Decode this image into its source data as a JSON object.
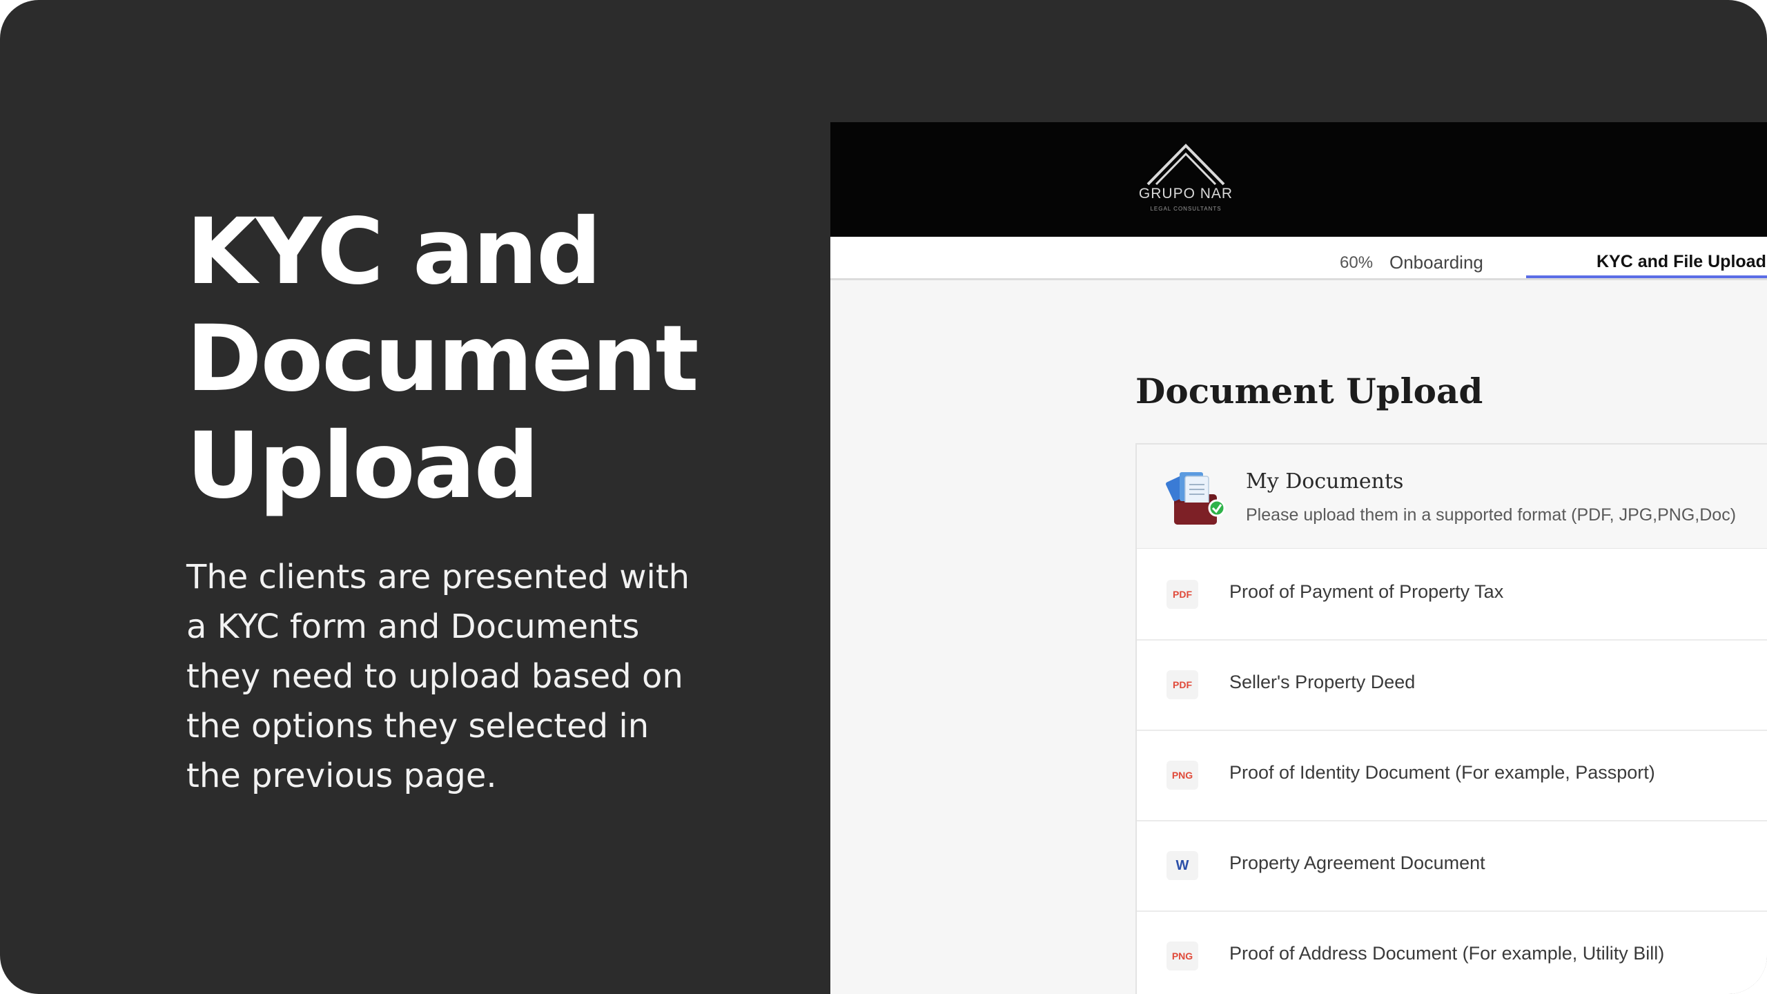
{
  "hero": {
    "title": "KYC and Document Upload",
    "description": "The clients are presented with a KYC form and Documents they need to upload based on the options they selected in the previous page."
  },
  "app": {
    "logo": {
      "wordmark": "GRUPO NAR",
      "subtitle": "LEGAL CONSULTANTS"
    },
    "tabs": {
      "progress": "60%",
      "onboarding": "Onboarding",
      "kyc": "KYC and File Upload"
    },
    "section_title": "Document Upload",
    "my_documents": {
      "title": "My Documents",
      "subtitle": "Please upload them in a supported format (PDF, JPG,PNG,Doc)"
    },
    "documents": [
      {
        "badge": "PDF",
        "label": "Proof of Payment of Property Tax"
      },
      {
        "badge": "PDF",
        "label": "Seller's Property Deed"
      },
      {
        "badge": "PNG",
        "label": "Proof of Identity Document (For example, Passport)"
      },
      {
        "badge": "W",
        "label": "Property Agreement Document"
      },
      {
        "badge": "PNG",
        "label": "Proof of Address Document (For example, Utility Bill)"
      }
    ],
    "colors": {
      "accent": "#5b6de6",
      "header_bg": "#050505",
      "pdf_badge": "#e04a3a",
      "word_badge": "#2b4fa8"
    }
  }
}
